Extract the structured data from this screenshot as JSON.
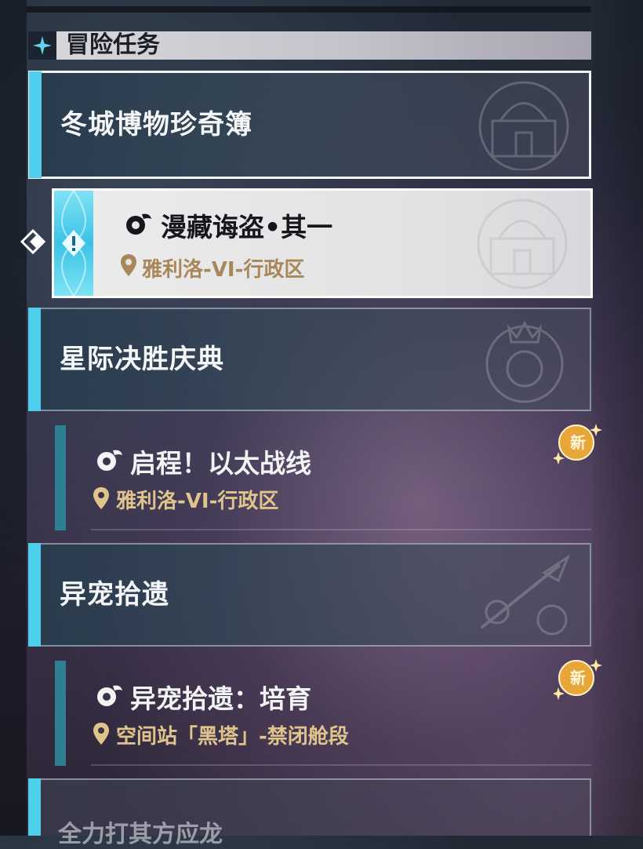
{
  "section": {
    "title": "冒险任务"
  },
  "categories": [
    {
      "label": "冬城博物珍奇簿"
    },
    {
      "label": "星际决胜庆典"
    },
    {
      "label": "异宠拾遗"
    },
    {
      "label": "全力打其方应龙"
    }
  ],
  "quests": [
    {
      "title": "漫藏诲盗•其一",
      "location": "雅利洛-VI-行政区",
      "selected": true
    },
    {
      "title": "启程！以太战线",
      "location": "雅利洛-VI-行政区",
      "badge": "新"
    },
    {
      "title": "异宠拾遗：培育",
      "location": "空间站「黑塔」-禁闭舱段",
      "badge": "新"
    }
  ],
  "colors": {
    "accent": "#4ed0ec",
    "location_text": "#e0c48c",
    "badge": "#e8a638"
  }
}
